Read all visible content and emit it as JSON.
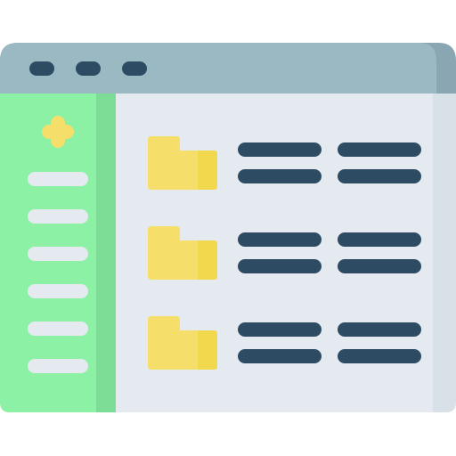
{
  "icon": {
    "subject": "file-manager-window-icon",
    "colors": {
      "title_bar": "#9bb9c3",
      "title_bar_shade": "#8aa6b2",
      "title_dots": "#2d4b63",
      "content_bg": "#e5eaf0",
      "content_shade": "#d8e0e8",
      "sidebar": "#8cf0a5",
      "sidebar_shade": "#7ddd96",
      "sidebar_lines": "#e5eaf0",
      "plus": "#f5df6a",
      "folder": "#f5df6a",
      "folder_front": "#f2d84c",
      "text_lines": "#2d4b63"
    },
    "window_dots": 3,
    "sidebar_lines": 6,
    "file_rows": [
      {
        "icon": "folder-icon",
        "columns": 2,
        "lines_per_column": 2
      },
      {
        "icon": "folder-icon",
        "columns": 2,
        "lines_per_column": 2
      },
      {
        "icon": "folder-icon",
        "columns": 2,
        "lines_per_column": 2
      }
    ]
  }
}
